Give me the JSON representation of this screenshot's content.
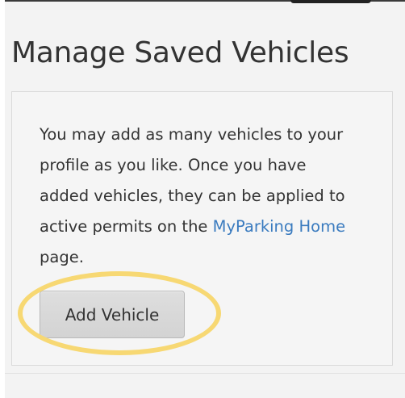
{
  "page": {
    "title": "Manage Saved Vehicles"
  },
  "panel": {
    "description_before_link": "You may add as many vehicles to your profile as you like. Once you have added vehicles, they can be applied to active permits on the ",
    "link_text": "MyParking Home",
    "description_after_link": " page.",
    "add_button_label": "Add Vehicle"
  },
  "colors": {
    "link": "#3a7bbf",
    "highlight": "#f7d873",
    "text": "#333333"
  }
}
